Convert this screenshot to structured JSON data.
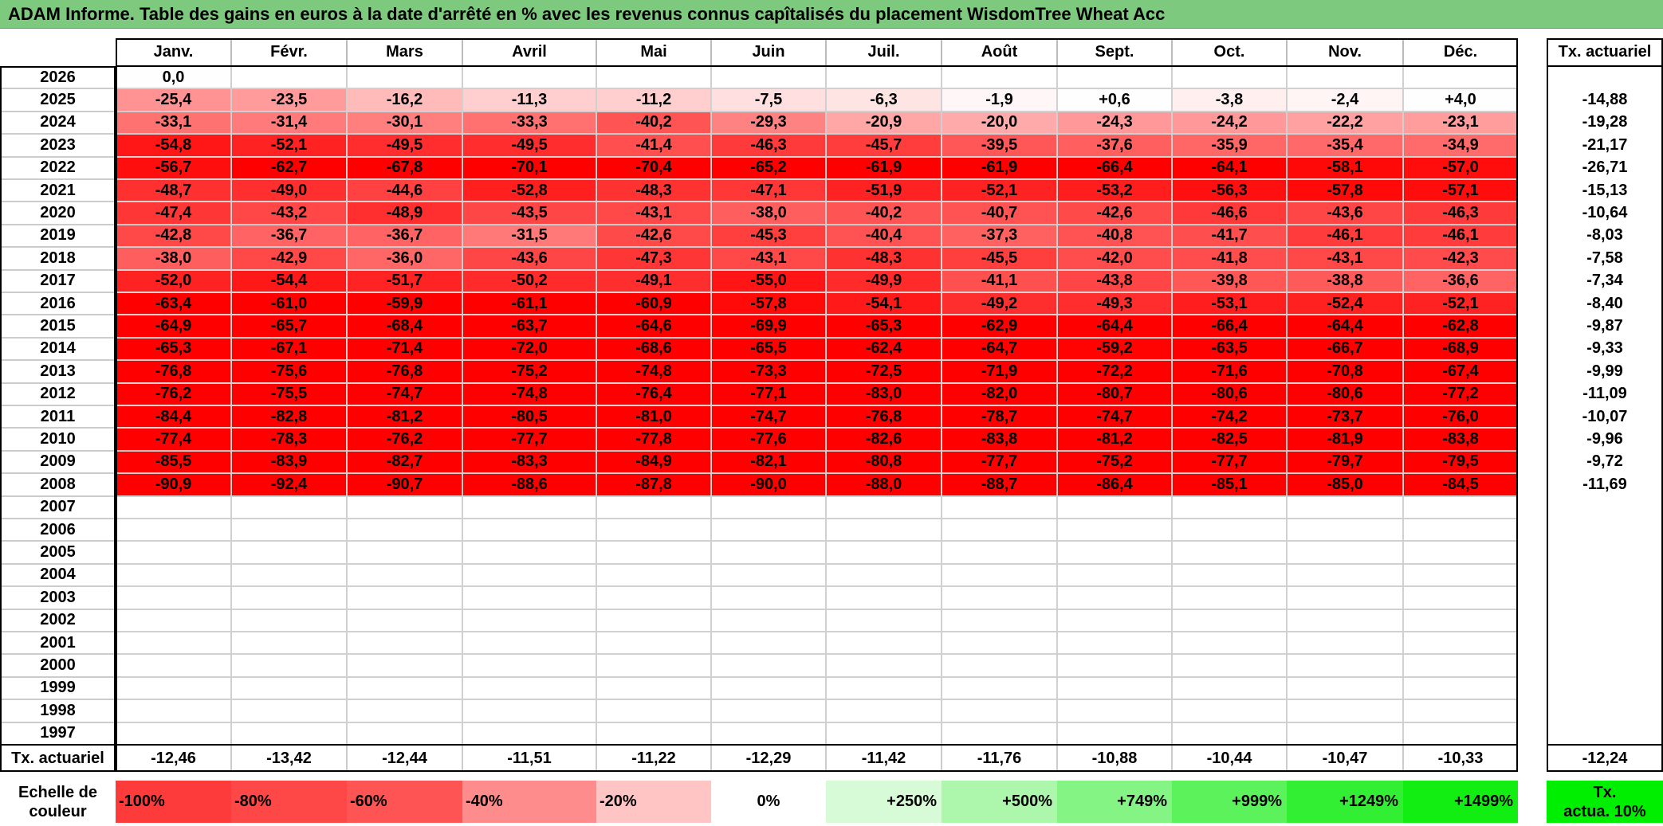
{
  "title": "ADAM Informe. Table des gains en euros à la date d'arrêté en % avec les revenus connus capîtalisés du placement WisdomTree Wheat Acc",
  "colors": {
    "title_bg": "#7dc97d",
    "neg_100": "#ff0000",
    "neg_0": "#ffffff",
    "pos_full": "#00ff00"
  },
  "chart_data": {
    "type": "heatmap",
    "title": "ADAM Informe. Table des gains en euros à la date d'arrêté en % avec les revenus connus capîtalisés du placement WisdomTree Wheat Acc",
    "months": [
      "Janv.",
      "Févr.",
      "Mars",
      "Avril",
      "Mai",
      "Juin",
      "Juil.",
      "Août",
      "Sept.",
      "Oct.",
      "Nov.",
      "Déc."
    ],
    "annual_header": "Tx. actuariel",
    "rows": [
      {
        "year": "2026",
        "values": [
          "0,0",
          "",
          "",
          "",
          "",
          "",
          "",
          "",
          "",
          "",
          "",
          ""
        ],
        "annual": ""
      },
      {
        "year": "2025",
        "values": [
          "-25,4",
          "-23,5",
          "-16,2",
          "-11,3",
          "-11,2",
          "-7,5",
          "-6,3",
          "-1,9",
          "+0,6",
          "-3,8",
          "-2,4",
          "+4,0"
        ],
        "annual": "-14,88"
      },
      {
        "year": "2024",
        "values": [
          "-33,1",
          "-31,4",
          "-30,1",
          "-33,3",
          "-40,2",
          "-29,3",
          "-20,9",
          "-20,0",
          "-24,3",
          "-24,2",
          "-22,2",
          "-23,1"
        ],
        "annual": "-19,28"
      },
      {
        "year": "2023",
        "values": [
          "-54,8",
          "-52,1",
          "-49,5",
          "-49,5",
          "-41,4",
          "-46,3",
          "-45,7",
          "-39,5",
          "-37,6",
          "-35,9",
          "-35,4",
          "-34,9"
        ],
        "annual": "-21,17"
      },
      {
        "year": "2022",
        "values": [
          "-56,7",
          "-62,7",
          "-67,8",
          "-70,1",
          "-70,4",
          "-65,2",
          "-61,9",
          "-61,9",
          "-66,4",
          "-64,1",
          "-58,1",
          "-57,0"
        ],
        "annual": "-26,71"
      },
      {
        "year": "2021",
        "values": [
          "-48,7",
          "-49,0",
          "-44,6",
          "-52,8",
          "-48,3",
          "-47,1",
          "-51,9",
          "-52,1",
          "-53,2",
          "-56,3",
          "-57,8",
          "-57,1"
        ],
        "annual": "-15,13"
      },
      {
        "year": "2020",
        "values": [
          "-47,4",
          "-43,2",
          "-48,9",
          "-43,5",
          "-43,1",
          "-38,0",
          "-40,2",
          "-40,7",
          "-42,6",
          "-46,6",
          "-43,6",
          "-46,3"
        ],
        "annual": "-10,64"
      },
      {
        "year": "2019",
        "values": [
          "-42,8",
          "-36,7",
          "-36,7",
          "-31,5",
          "-42,6",
          "-45,3",
          "-40,4",
          "-37,3",
          "-40,8",
          "-41,7",
          "-46,1",
          "-46,1"
        ],
        "annual": "-8,03"
      },
      {
        "year": "2018",
        "values": [
          "-38,0",
          "-42,9",
          "-36,0",
          "-43,6",
          "-47,3",
          "-43,1",
          "-48,3",
          "-45,5",
          "-42,0",
          "-41,8",
          "-43,1",
          "-42,3"
        ],
        "annual": "-7,58"
      },
      {
        "year": "2017",
        "values": [
          "-52,0",
          "-54,4",
          "-51,7",
          "-50,2",
          "-49,1",
          "-55,0",
          "-49,9",
          "-41,1",
          "-43,8",
          "-39,8",
          "-38,8",
          "-36,6"
        ],
        "annual": "-7,34"
      },
      {
        "year": "2016",
        "values": [
          "-63,4",
          "-61,0",
          "-59,9",
          "-61,1",
          "-60,9",
          "-57,8",
          "-54,1",
          "-49,2",
          "-49,3",
          "-53,1",
          "-52,4",
          "-52,1"
        ],
        "annual": "-8,40"
      },
      {
        "year": "2015",
        "values": [
          "-64,9",
          "-65,7",
          "-68,4",
          "-63,7",
          "-64,6",
          "-69,9",
          "-65,3",
          "-62,9",
          "-64,4",
          "-66,4",
          "-64,4",
          "-62,8"
        ],
        "annual": "-9,87"
      },
      {
        "year": "2014",
        "values": [
          "-65,3",
          "-67,1",
          "-71,4",
          "-72,0",
          "-68,6",
          "-65,5",
          "-62,4",
          "-64,7",
          "-59,2",
          "-63,5",
          "-66,7",
          "-68,9"
        ],
        "annual": "-9,33"
      },
      {
        "year": "2013",
        "values": [
          "-76,8",
          "-75,6",
          "-76,8",
          "-75,2",
          "-74,8",
          "-73,3",
          "-72,5",
          "-71,9",
          "-72,2",
          "-71,6",
          "-70,8",
          "-67,4"
        ],
        "annual": "-9,99"
      },
      {
        "year": "2012",
        "values": [
          "-76,2",
          "-75,5",
          "-74,7",
          "-74,8",
          "-76,4",
          "-77,1",
          "-83,0",
          "-82,0",
          "-80,7",
          "-80,6",
          "-80,6",
          "-77,2"
        ],
        "annual": "-11,09"
      },
      {
        "year": "2011",
        "values": [
          "-84,4",
          "-82,8",
          "-81,2",
          "-80,5",
          "-81,0",
          "-74,7",
          "-76,8",
          "-78,7",
          "-74,7",
          "-74,2",
          "-73,7",
          "-76,0"
        ],
        "annual": "-10,07"
      },
      {
        "year": "2010",
        "values": [
          "-77,4",
          "-78,3",
          "-76,2",
          "-77,7",
          "-77,8",
          "-77,6",
          "-82,6",
          "-83,8",
          "-81,2",
          "-82,5",
          "-81,9",
          "-83,8"
        ],
        "annual": "-9,96"
      },
      {
        "year": "2009",
        "values": [
          "-85,5",
          "-83,9",
          "-82,7",
          "-83,3",
          "-84,9",
          "-82,1",
          "-80,8",
          "-77,7",
          "-75,2",
          "-77,7",
          "-79,7",
          "-79,5"
        ],
        "annual": "-9,72"
      },
      {
        "year": "2008",
        "values": [
          "-90,9",
          "-92,4",
          "-90,7",
          "-88,6",
          "-87,8",
          "-90,0",
          "-88,0",
          "-88,7",
          "-86,4",
          "-85,1",
          "-85,0",
          "-84,5"
        ],
        "annual": "-11,69"
      },
      {
        "year": "2007",
        "values": [
          "",
          "",
          "",
          "",
          "",
          "",
          "",
          "",
          "",
          "",
          "",
          ""
        ],
        "annual": ""
      },
      {
        "year": "2006",
        "values": [
          "",
          "",
          "",
          "",
          "",
          "",
          "",
          "",
          "",
          "",
          "",
          ""
        ],
        "annual": ""
      },
      {
        "year": "2005",
        "values": [
          "",
          "",
          "",
          "",
          "",
          "",
          "",
          "",
          "",
          "",
          "",
          ""
        ],
        "annual": ""
      },
      {
        "year": "2004",
        "values": [
          "",
          "",
          "",
          "",
          "",
          "",
          "",
          "",
          "",
          "",
          "",
          ""
        ],
        "annual": ""
      },
      {
        "year": "2003",
        "values": [
          "",
          "",
          "",
          "",
          "",
          "",
          "",
          "",
          "",
          "",
          "",
          ""
        ],
        "annual": ""
      },
      {
        "year": "2002",
        "values": [
          "",
          "",
          "",
          "",
          "",
          "",
          "",
          "",
          "",
          "",
          "",
          ""
        ],
        "annual": ""
      },
      {
        "year": "2001",
        "values": [
          "",
          "",
          "",
          "",
          "",
          "",
          "",
          "",
          "",
          "",
          "",
          ""
        ],
        "annual": ""
      },
      {
        "year": "2000",
        "values": [
          "",
          "",
          "",
          "",
          "",
          "",
          "",
          "",
          "",
          "",
          "",
          ""
        ],
        "annual": ""
      },
      {
        "year": "1999",
        "values": [
          "",
          "",
          "",
          "",
          "",
          "",
          "",
          "",
          "",
          "",
          "",
          ""
        ],
        "annual": ""
      },
      {
        "year": "1998",
        "values": [
          "",
          "",
          "",
          "",
          "",
          "",
          "",
          "",
          "",
          "",
          "",
          ""
        ],
        "annual": ""
      },
      {
        "year": "1997",
        "values": [
          "",
          "",
          "",
          "",
          "",
          "",
          "",
          "",
          "",
          "",
          "",
          ""
        ],
        "annual": ""
      }
    ],
    "footer": {
      "label": "Tx. actuariel",
      "values": [
        "-12,46",
        "-13,42",
        "-12,44",
        "-11,51",
        "-11,22",
        "-12,29",
        "-11,42",
        "-11,76",
        "-10,88",
        "-10,44",
        "-10,47",
        "-10,33"
      ],
      "annual": "-12,24"
    },
    "scale": {
      "label_line1": "Echelle de",
      "label_line2": "couleur",
      "items": [
        {
          "label": "-100%",
          "color": "#fe3b3b",
          "align": "left"
        },
        {
          "label": "-80%",
          "color": "#fe4848",
          "align": "left"
        },
        {
          "label": "-60%",
          "color": "#fe5454",
          "align": "left"
        },
        {
          "label": "-40%",
          "color": "#fe8c8c",
          "align": "left"
        },
        {
          "label": "-20%",
          "color": "#ffc4c4",
          "align": "left"
        },
        {
          "label": "0%",
          "color": "#ffffff",
          "align": "center"
        },
        {
          "label": "+250%",
          "color": "#d6fbd6",
          "align": "right"
        },
        {
          "label": "+500%",
          "color": "#adf7ad",
          "align": "right"
        },
        {
          "label": "+749%",
          "color": "#84f584",
          "align": "right"
        },
        {
          "label": "+999%",
          "color": "#5bf25b",
          "align": "right"
        },
        {
          "label": "+1249%",
          "color": "#33ef33",
          "align": "right"
        },
        {
          "label": "+1499%",
          "color": "#12ee12",
          "align": "right"
        }
      ],
      "annual_label_line1": "Tx.",
      "annual_label_line2": "actua. 10%",
      "annual_color": "#00ee00"
    }
  }
}
